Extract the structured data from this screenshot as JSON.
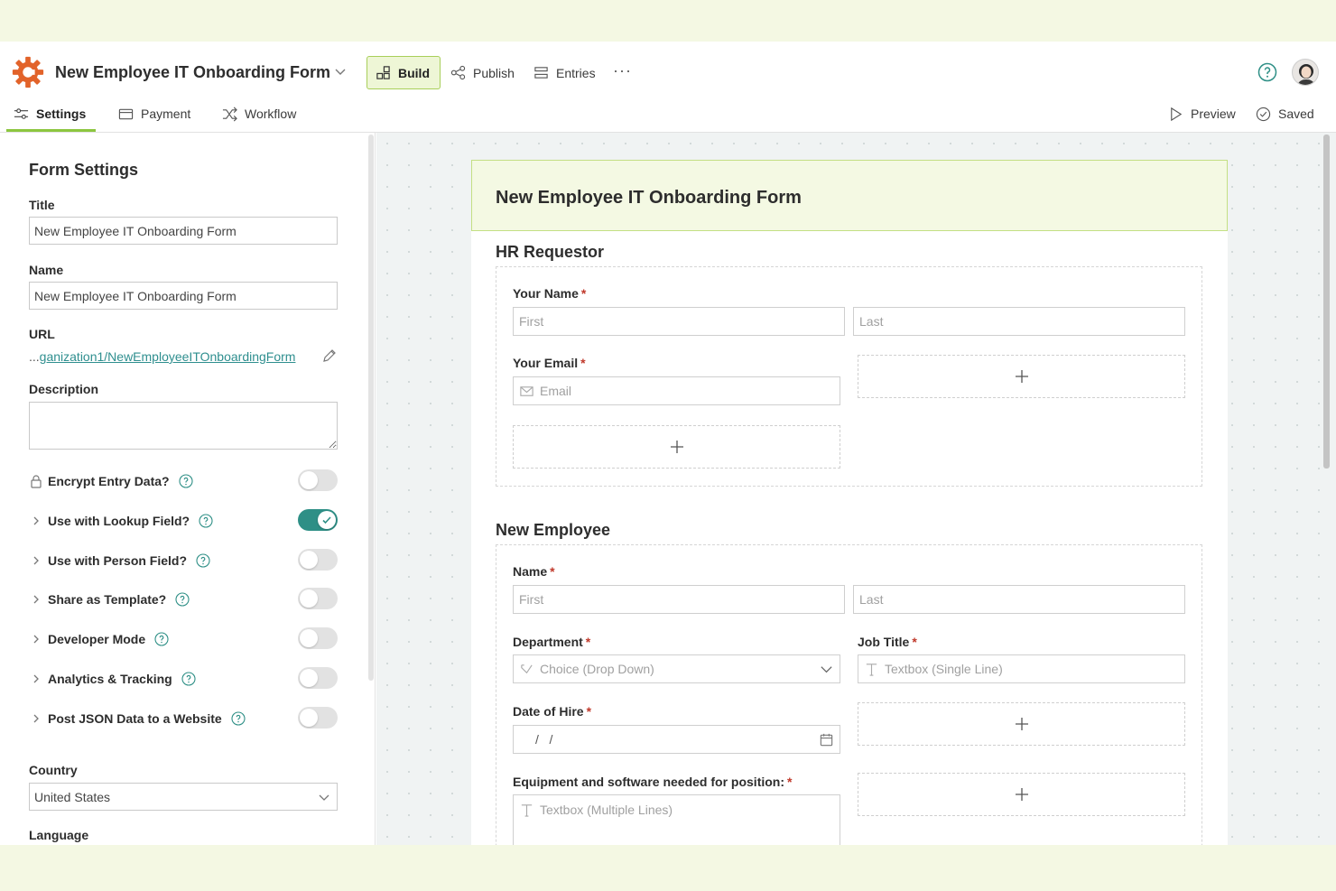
{
  "app": {
    "form_title": "New Employee IT Onboarding Form",
    "brand_color": "#e2632a",
    "accent_color": "#8cc63f"
  },
  "toolbar": {
    "tabs": [
      {
        "label": "Build",
        "icon": "build-icon",
        "active": true
      },
      {
        "label": "Publish",
        "icon": "share-icon"
      },
      {
        "label": "Entries",
        "icon": "list-icon"
      }
    ],
    "more": "···"
  },
  "subnav": {
    "tabs": [
      {
        "label": "Settings",
        "icon": "sliders-icon",
        "active": true
      },
      {
        "label": "Payment",
        "icon": "card-icon"
      },
      {
        "label": "Workflow",
        "icon": "shuffle-icon"
      }
    ],
    "preview": "Preview",
    "saved": "Saved"
  },
  "settings": {
    "heading": "Form Settings",
    "title_label": "Title",
    "title_value": "New Employee IT Onboarding Form",
    "name_label": "Name",
    "name_value": "New Employee IT Onboarding Form",
    "url_label": "URL",
    "url_prefix": "...",
    "url_value": "ganization1/NewEmployeeITOnboardingForm",
    "description_label": "Description",
    "options": [
      {
        "label": "Encrypt Entry Data?",
        "icon": "lock-icon",
        "on": false
      },
      {
        "label": "Use with Lookup Field?",
        "icon": "chevron-right-icon",
        "on": true
      },
      {
        "label": "Use with Person Field?",
        "icon": "chevron-right-icon",
        "on": false
      },
      {
        "label": "Share as Template?",
        "icon": "chevron-right-icon",
        "on": false
      },
      {
        "label": "Developer Mode",
        "icon": "chevron-right-icon",
        "on": false
      },
      {
        "label": "Analytics & Tracking",
        "icon": "chevron-right-icon",
        "on": false
      },
      {
        "label": "Post JSON Data to a Website",
        "icon": "chevron-right-icon",
        "on": false
      }
    ],
    "country_label": "Country",
    "country_value": "United States",
    "language_label": "Language"
  },
  "form": {
    "header_title": "New Employee IT Onboarding Form",
    "sections": [
      {
        "title": "HR Requestor",
        "your_name_label": "Your Name",
        "first_placeholder": "First",
        "last_placeholder": "Last",
        "your_email_label": "Your Email",
        "email_placeholder": "Email"
      },
      {
        "title": "New Employee",
        "name_label": "Name",
        "first_placeholder": "First",
        "last_placeholder": "Last",
        "department_label": "Department",
        "department_placeholder": "Choice (Drop Down)",
        "job_title_label": "Job Title",
        "job_title_placeholder": "Textbox (Single Line)",
        "date_label": "Date of Hire",
        "date_placeholder": "/   /",
        "equipment_label": "Equipment and software needed for position:",
        "equipment_placeholder": "Textbox (Multiple Lines)"
      }
    ],
    "required_mark": "*"
  }
}
